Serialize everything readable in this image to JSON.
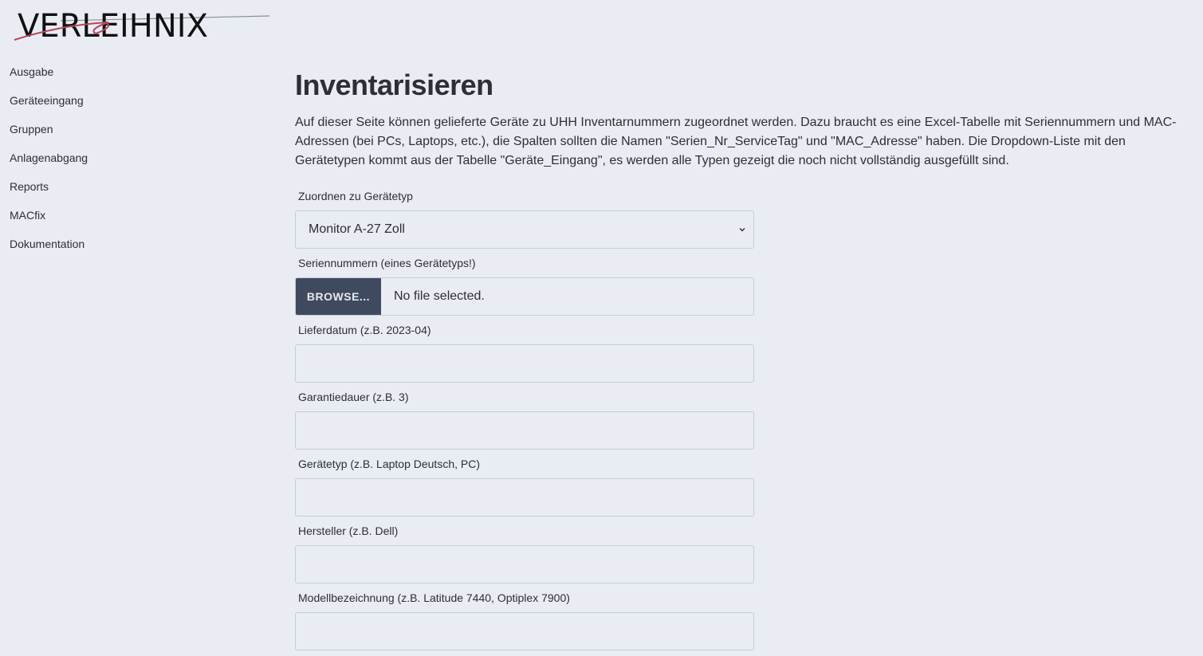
{
  "logo": {
    "text": "VERLEIHNIX"
  },
  "sidebar": {
    "items": [
      {
        "label": "Ausgabe"
      },
      {
        "label": "Geräteeingang"
      },
      {
        "label": "Gruppen"
      },
      {
        "label": "Anlagenabgang"
      },
      {
        "label": "Reports"
      },
      {
        "label": "MACfix"
      },
      {
        "label": "Dokumentation"
      }
    ]
  },
  "main": {
    "title": "Inventarisieren",
    "intro": "Auf dieser Seite können gelieferte Geräte zu UHH Inventarnummern zugeordnet werden. Dazu braucht es eine Excel-Tabelle mit Seriennummern und MAC-Adressen (bei PCs, Laptops, etc.), die Spalten sollten die Namen \"Serien_Nr_ServiceTag\" und \"MAC_Adresse\" haben. Die Dropdown-Liste mit den Gerätetypen kommt aus der Tabelle \"Geräte_Eingang\", es werden alle Typen gezeigt die noch nicht vollständig ausgefüllt sind."
  },
  "form": {
    "device_type": {
      "label": "Zuordnen zu Gerätetyp",
      "value": "Monitor A-27 Zoll"
    },
    "serials": {
      "label": "Seriennummern (eines Gerätetyps!)",
      "button": "BROWSE...",
      "status": "No file selected."
    },
    "delivery_date": {
      "label": "Lieferdatum (z.B. 2023-04)",
      "value": ""
    },
    "warranty": {
      "label": "Garantiedauer (z.B. 3)",
      "value": ""
    },
    "type": {
      "label": "Gerätetyp (z.B. Laptop Deutsch, PC)",
      "value": ""
    },
    "manufacturer": {
      "label": "Hersteller (z.B. Dell)",
      "value": ""
    },
    "model": {
      "label": "Modellbezeichnung (z.B. Latitude 7440, Optiplex 7900)",
      "value": ""
    }
  },
  "colors": {
    "background": "#e9ecf3",
    "text": "#2c2f36",
    "button": "#404a5e",
    "logo_accent": "#b5485a"
  }
}
